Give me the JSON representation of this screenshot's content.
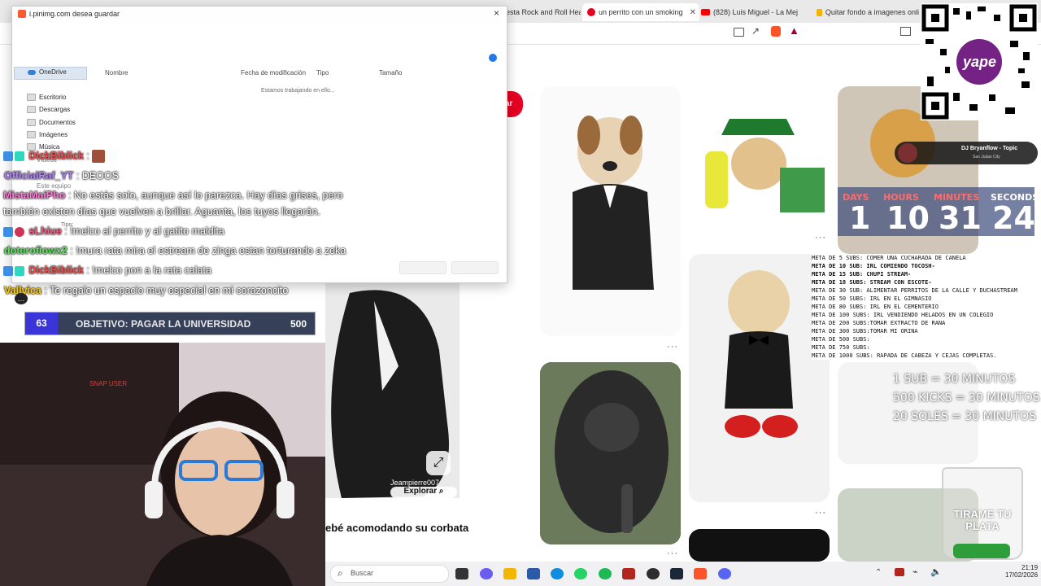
{
  "browser": {
    "tabs": [
      {
        "label": "esta Rock and Roll Hea",
        "active": false
      },
      {
        "label": "un perrito con un smoking",
        "active": true
      },
      {
        "label": "(828) Luis Miguel - La Mej",
        "active": false
      },
      {
        "label": "Quitar fondo a imagenes onli",
        "active": false
      }
    ]
  },
  "dialog": {
    "title": "i.pinimg.com desea guardar",
    "close": "×",
    "sidebar": {
      "onedrive": "OneDrive",
      "items": [
        "Escritorio",
        "Descargas",
        "Documentos",
        "Imágenes",
        "Música",
        "Vídeos"
      ],
      "this_pc": "Este equipo"
    },
    "columns": [
      "Nombre",
      "Fecha de modificación",
      "Tipo",
      "Tamaño"
    ],
    "working": "Estamos trabajando en ello...",
    "type_label": "Tipo:"
  },
  "chat": [
    {
      "user": "DickBiblick",
      "msg": "",
      "color": "#ff4d4d",
      "badges": true
    },
    {
      "user": "OfficialRaf_YT",
      "msg": ": DEOOS",
      "color": "#b184ff"
    },
    {
      "user": "MistaMaiPho",
      "msg": ": No estás solo, aunque así lo parezca. Hay días grises, pero",
      "color": "#ff7ad9"
    },
    {
      "user": "",
      "msg": "también existen días que vuelven a brillar. Aguanta, los tuyos llegarán.",
      "color": "#ffffff"
    },
    {
      "user": "sLhiue",
      "msg": ": !melco al perrito y al gatito maldita",
      "color": "#ff5c8a",
      "badges": true
    },
    {
      "user": "doterofiowx2",
      "msg": ": !mura rata mira el estream de zinga estan torturando a zeka",
      "color": "#5ce65c"
    },
    {
      "user": "DickBiblick",
      "msg": ": !melco pon a la rata calata",
      "color": "#ff4d4d",
      "badges": true
    },
    {
      "user": "Vallvica",
      "msg": ": Te regalo un espacio muy especial en mi corazoncito",
      "color": "#ffcc00"
    }
  ],
  "goal": {
    "current": "63",
    "label": "OBJETIVO: PAGAR LA UNIVERSIDAD",
    "target": "500"
  },
  "webcam": {
    "sign": "SNAP USER"
  },
  "pin": {
    "caption": "ebé acomodando su corbata",
    "user": "Jeampierre007",
    "explore": "Explorar",
    "save": "ar"
  },
  "music": {
    "title": "DJ Bryanflow - Topic",
    "sub": "San Judas City"
  },
  "countdown": [
    {
      "label": "DAYS",
      "value": "1"
    },
    {
      "label": "HOURS",
      "value": "10"
    },
    {
      "label": "MINUTES",
      "value": "31"
    },
    {
      "label": "SECONDS",
      "value": "24"
    }
  ],
  "metas": [
    {
      "t": "META DE 5 SUBS: COMER UNA CUCHARADA DE CANELA",
      "b": false
    },
    {
      "t": "META DE 10 SUB: IRL COMIENDO TOCOSH-",
      "b": true
    },
    {
      "t": "META DE 15 SUB: CHUPI STREAM-",
      "b": true
    },
    {
      "t": "META DE 18 SUBS: STREAM CON ESCOTE-",
      "b": true
    },
    {
      "t": "META DE 30 SUB:  ALIMENTAR PERRITOS DE LA CALLE Y DUCHASTREAM",
      "b": false
    },
    {
      "t": "META DE 50 SUBS: IRL EN EL GIMNASIO",
      "b": false
    },
    {
      "t": "META DE 80 SUBS: IRL EN EL CEMENTERIO",
      "b": false
    },
    {
      "t": "META DE 100 SUBS: IRL VENDIENDO HELADOS EN UN COLEGIO",
      "b": false
    },
    {
      "t": "META DE 200 SUBS:TOMAR EXTRACTO DE RANA",
      "b": false
    },
    {
      "t": "META DE 300 SUBS:TOMAR MI ORINA",
      "b": false
    },
    {
      "t": "META DE 500 SUBS:",
      "b": false
    },
    {
      "t": "META DE 750 SUBS:",
      "b": false
    },
    {
      "t": "META DE 1000 SUBS: RAPADA DE CABEZA Y CEJAS COMPLETAS.",
      "b": false
    }
  ],
  "rules": [
    "1 SUB = 30 MINUTOS",
    "500 KICKS = 30 MINUTOS",
    "20 SOLES = 30 MINUTOS"
  ],
  "jar": "TIRAME TU PLATA",
  "yape": "yape",
  "taskbar": {
    "search": "Buscar",
    "time": "21:19",
    "date": "17/02/2026"
  },
  "colors": {
    "pinterest_red": "#e60023",
    "countdown_bg": "#3b4a7a",
    "goal_num": "#3a35d8"
  }
}
